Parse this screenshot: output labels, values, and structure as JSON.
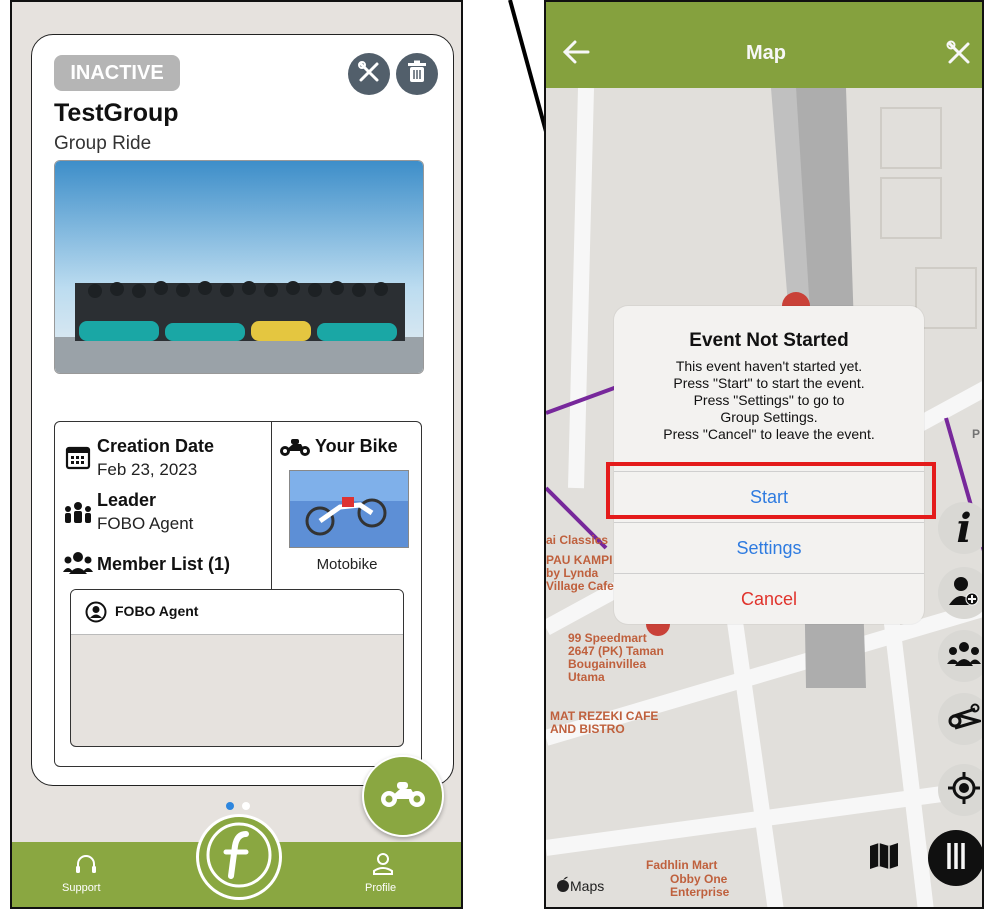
{
  "left": {
    "badge": "INACTIVE",
    "title": "TestGroup",
    "subtitle": "Group Ride",
    "creation_label": "Creation Date",
    "creation_value": "Feb 23, 2023",
    "leader_label": "Leader",
    "leader_value": "FOBO Agent",
    "member_list_label": "Member List (1)",
    "your_bike_label": "Your Bike",
    "bike_name": "Motobike",
    "members": [
      {
        "name": "FOBO Agent"
      }
    ],
    "tabs": {
      "support": "Support",
      "profile": "Profile"
    },
    "page_dots": {
      "active": 1,
      "total": 2
    },
    "colors": {
      "accent": "#8aa741",
      "badge": "#b5b5b5",
      "dot_active": "#2e86de"
    }
  },
  "right": {
    "nav_title": "Map",
    "alert": {
      "title": "Event Not Started",
      "lines": [
        "This event haven't started yet.",
        "Press \"Start\" to start the event.",
        "Press \"Settings\" to go to",
        "Group Settings.",
        "Press \"Cancel\" to leave the event."
      ],
      "start": "Start",
      "settings": "Settings",
      "cancel": "Cancel"
    },
    "map_labels": {
      "classics": "ai Classics",
      "kampung": "PAU KAMPI\nby Lynda\nVillage Cafe",
      "speedmart": "99 Speedmart\n2647 (PK) Taman\nBougainvillea\nUtama",
      "rezeki": "MAT REZEKI CAFE\nAND BISTRO",
      "fadhlin": "Fadhlin Mart",
      "obby": "Obby One\nEnterprise",
      "maps": "Maps",
      "edge_p": "P"
    },
    "colors": {
      "accent": "#8aa741",
      "link_blue": "#2e7be0",
      "cancel_red": "#e0332c",
      "highlight": "#e41b1b"
    }
  }
}
